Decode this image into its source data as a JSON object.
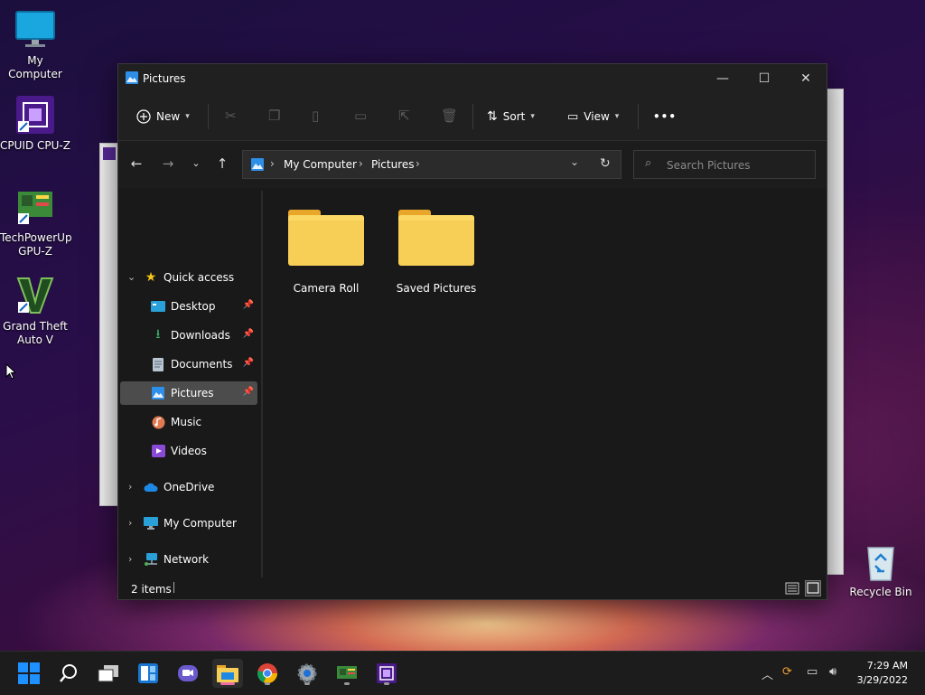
{
  "desktop": {
    "icons": [
      {
        "label": "My Computer"
      },
      {
        "label": "CPUID CPU-Z"
      },
      {
        "label": "TechPowerUp GPU-Z"
      },
      {
        "label": "Grand Theft Auto V"
      },
      {
        "label": "Recycle Bin"
      }
    ]
  },
  "window": {
    "title": "Pictures",
    "controls": {
      "minimize": "—",
      "maximize": "☐",
      "close": "✕"
    }
  },
  "toolbar": {
    "new_label": "New",
    "sort_label": "Sort",
    "view_label": "View",
    "more_label": "•••"
  },
  "address": {
    "crumbs": [
      "My Computer",
      "Pictures"
    ],
    "separator": "›"
  },
  "search": {
    "placeholder": "Search Pictures"
  },
  "nav": {
    "quick_access": "Quick access",
    "items": [
      {
        "label": "Desktop"
      },
      {
        "label": "Downloads"
      },
      {
        "label": "Documents"
      },
      {
        "label": "Pictures"
      },
      {
        "label": "Music"
      },
      {
        "label": "Videos"
      }
    ],
    "onedrive": "OneDrive",
    "my_computer": "My Computer",
    "network": "Network"
  },
  "content": {
    "folders": [
      {
        "label": "Camera Roll"
      },
      {
        "label": "Saved Pictures"
      }
    ]
  },
  "status": {
    "items": "2 items"
  },
  "taskbar": {
    "time": "7:29 AM",
    "date": "3/29/2022"
  },
  "colors": {
    "accent": "#0078d4",
    "folder": "#f7cf57",
    "selection": "#4c4c4c"
  }
}
